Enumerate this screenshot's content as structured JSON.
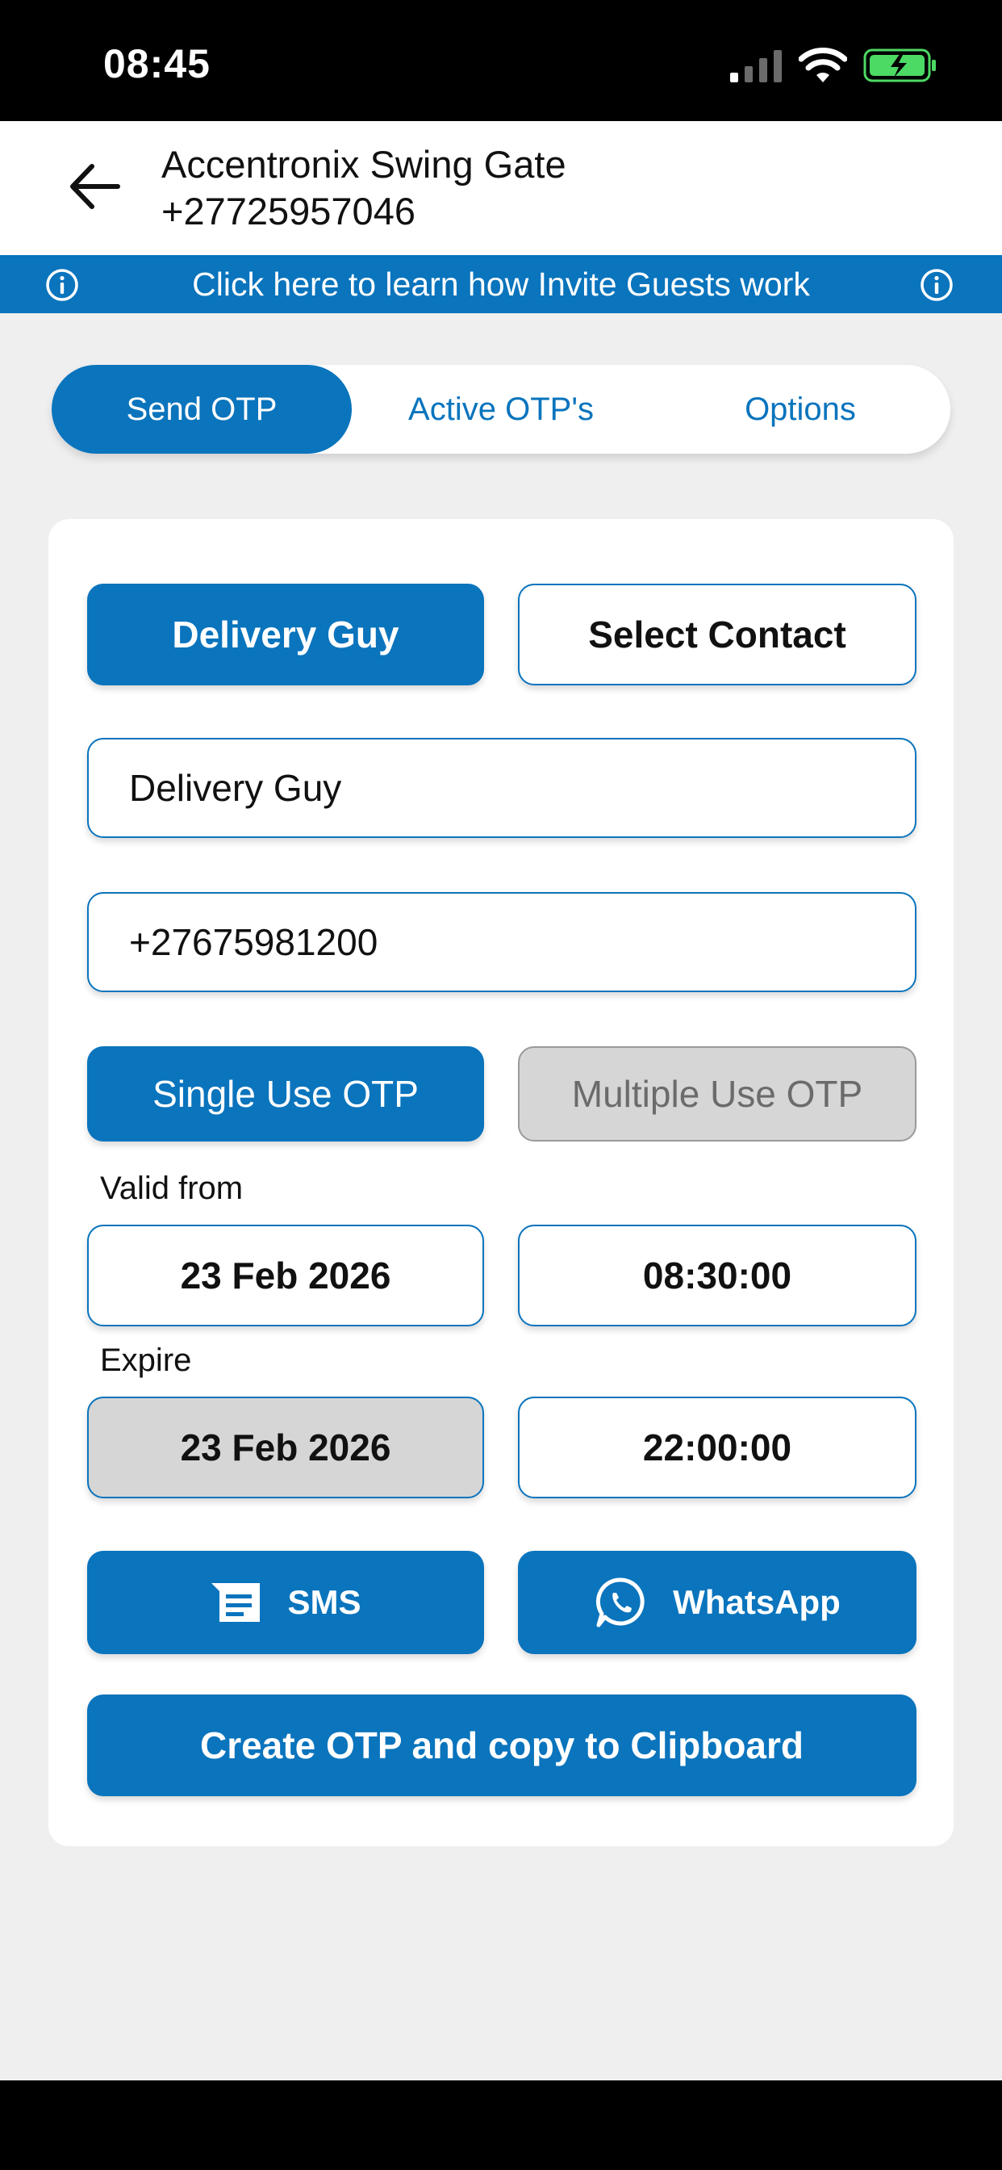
{
  "status_bar": {
    "time": "08:45"
  },
  "header": {
    "title": "Accentronix Swing Gate",
    "phone": "+27725957046"
  },
  "banner": {
    "text": "Click here to learn how Invite Guests work"
  },
  "tabs": [
    {
      "label": "Send OTP",
      "active": true
    },
    {
      "label": "Active OTP's",
      "active": false
    },
    {
      "label": "Options",
      "active": false
    }
  ],
  "form": {
    "guest_type_button": "Delivery Guy",
    "select_contact_button": "Select Contact",
    "name_value": "Delivery Guy",
    "phone_value": "+27675981200",
    "single_use_label": "Single Use OTP",
    "multiple_use_label": "Multiple Use OTP",
    "valid_from_label": "Valid from",
    "valid_from_date": "23 Feb 2026",
    "valid_from_time": "08:30:00",
    "expire_label": "Expire",
    "expire_date": "23 Feb 2026",
    "expire_time": "22:00:00",
    "sms_label": "SMS",
    "whatsapp_label": "WhatsApp",
    "create_label": "Create OTP and copy to Clipboard"
  },
  "colors": {
    "accent": "#0a74bd",
    "disabled": "#d6d6d6",
    "background": "#efeff0"
  }
}
